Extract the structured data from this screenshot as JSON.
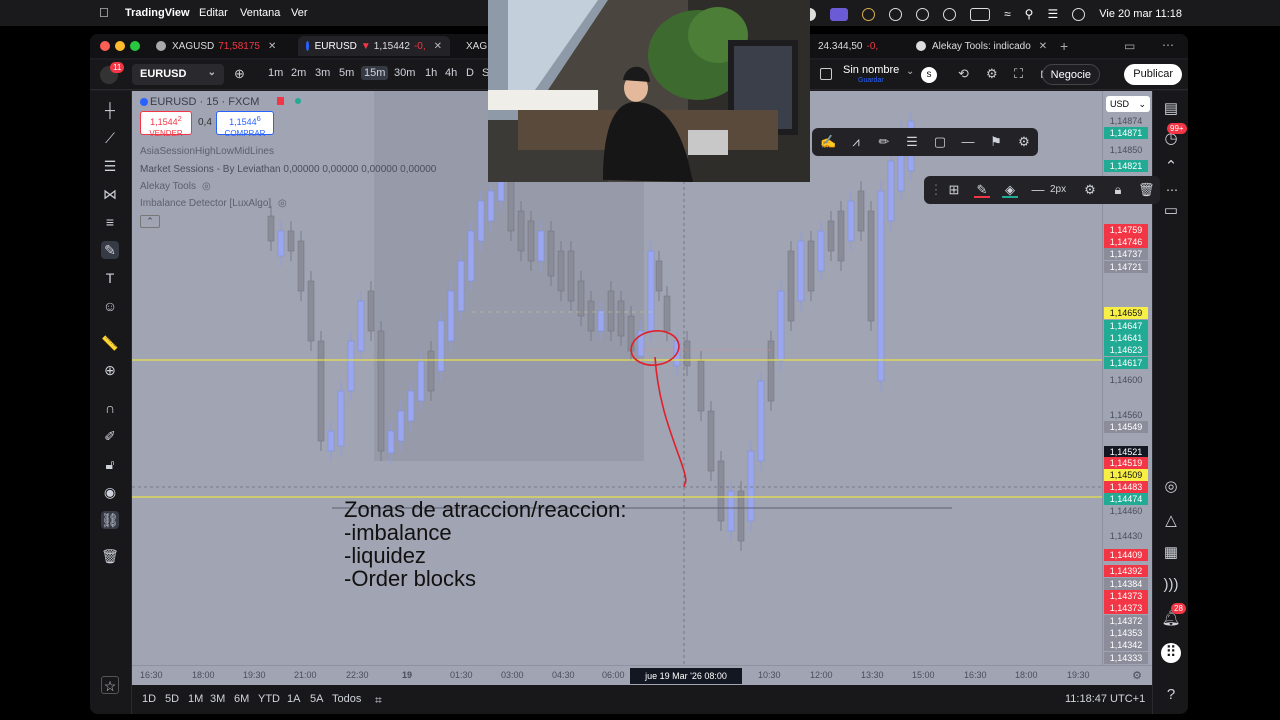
{
  "menubar": {
    "app_name": "TradingView",
    "items": [
      "Editar",
      "Ventana",
      "Ver"
    ],
    "datetime": "Vie 20 mar 11:18"
  },
  "tabs": [
    {
      "label": "XAGUSD",
      "price": "71,58175",
      "change_color": "#f23645"
    },
    {
      "label": "EURUSD",
      "price": "1,15442",
      "arrow": "▼",
      "change": "-0,",
      "change_color": "#f23645"
    },
    {
      "label": "XAG",
      "price": ""
    },
    {
      "label": "",
      "price": "24.344,50",
      "change": "-0,",
      "change_color": "#f23645"
    },
    {
      "label": "Alekay Tools: indicado",
      "price": ""
    }
  ],
  "toolbar": {
    "symbol": "EURUSD",
    "notification_count": "11",
    "timeframes": [
      "1m",
      "2m",
      "3m",
      "5m",
      "15m",
      "30m",
      "1h",
      "4h",
      "D",
      "S"
    ],
    "active_timeframe": "15m",
    "layout_name": "Sin nombre",
    "layout_sub": "Guardar",
    "account_initial": "s",
    "trade_label": "Negocie",
    "publish_label": "Publicar"
  },
  "legend": {
    "title": "EURUSD · 15 · FXCM",
    "sell_price": "1,1544",
    "sell_price_sup": "2",
    "sell_label": "VENDER",
    "spread": "0,4",
    "buy_price": "1,1544",
    "buy_price_sup": "6",
    "buy_label": "COMPRAR",
    "indicators": [
      "AsiaSessionHighLowMidLines",
      "Market Sessions - By Leviathan  0,00000  0,00000  0,00000  0,00000",
      "Alekay Tools",
      "Imbalance Detector [LuxAlgo]"
    ]
  },
  "annotation": {
    "lines": [
      "Zonas de atraccion/reaccion:",
      "-imbalance",
      "-liquidez",
      "-Order blocks"
    ]
  },
  "price_axis": {
    "currency": "USD",
    "labels": [
      {
        "text": "1,14874",
        "style": "plain"
      },
      {
        "text": "1,14871",
        "style": "green"
      },
      {
        "text": "1,14850",
        "style": "plain"
      },
      {
        "text": "1,14821",
        "style": "green"
      },
      {
        "text": "1,14759",
        "style": "red"
      },
      {
        "text": "1,14746",
        "style": "red"
      },
      {
        "text": "1,14737",
        "style": "gray"
      },
      {
        "text": "1,14721",
        "style": "gray"
      },
      {
        "text": "1,14659",
        "style": "yellow"
      },
      {
        "text": "1,14647",
        "style": "green"
      },
      {
        "text": "1,14641",
        "style": "green"
      },
      {
        "text": "1,14623",
        "style": "green"
      },
      {
        "text": "1,14617",
        "style": "green"
      },
      {
        "text": "1,14600",
        "style": "plain"
      },
      {
        "text": "1,14560",
        "style": "plain"
      },
      {
        "text": "1,14549",
        "style": "gray"
      },
      {
        "text": "1,14521",
        "style": "dark"
      },
      {
        "text": "1,14519",
        "style": "red"
      },
      {
        "text": "1,14509",
        "style": "yellow"
      },
      {
        "text": "1,14483",
        "style": "red"
      },
      {
        "text": "1,14474",
        "style": "green"
      },
      {
        "text": "1,14460",
        "style": "plain"
      },
      {
        "text": "1,14430",
        "style": "plain"
      },
      {
        "text": "1,14409",
        "style": "red"
      },
      {
        "text": "1,14392",
        "style": "red"
      },
      {
        "text": "1,14384",
        "style": "gray"
      },
      {
        "text": "1,14373",
        "style": "red"
      },
      {
        "text": "1,14373",
        "style": "red"
      },
      {
        "text": "1,14372",
        "style": "gray"
      },
      {
        "text": "1,14353",
        "style": "gray"
      },
      {
        "text": "1,14342",
        "style": "gray"
      },
      {
        "text": "1,14333",
        "style": "gray"
      }
    ]
  },
  "time_axis": {
    "labels": [
      "16:30",
      "18:00",
      "19:30",
      "21:00",
      "22:30",
      "19",
      "01:30",
      "03:00",
      "04:30",
      "06:00",
      "10:30",
      "12:00",
      "13:30",
      "15:00",
      "16:30",
      "18:00",
      "19:30"
    ],
    "crosshair_label": "jue 19 Mar '26   08:00"
  },
  "bottom_bar": {
    "ranges": [
      "1D",
      "5D",
      "1M",
      "3M",
      "6M",
      "YTD",
      "1A",
      "5A",
      "Todos"
    ],
    "clock": "11:18:47 UTC+1"
  },
  "right_rail": {
    "badge_top": "99+",
    "badge_bottom": "28"
  },
  "floating_toolbar": {
    "width_label": "2px"
  },
  "colors": {
    "chart_bg": "#a0a4b3",
    "bull_candle": "#9aa7ee",
    "bear_candle": "#8a8d98",
    "yellow_line": "#e8e04a",
    "annotation_red": "#e0202a",
    "price_red": "#f23645",
    "price_green": "#22ab94"
  }
}
